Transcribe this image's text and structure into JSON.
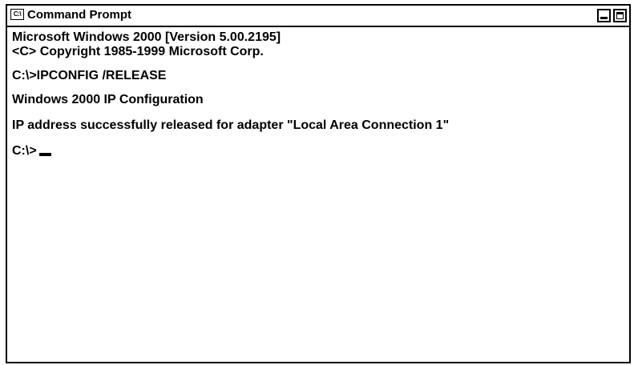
{
  "window": {
    "title": "Command Prompt",
    "icon_label": "C:\\",
    "icon": "console-icon"
  },
  "controls": {
    "minimize_icon": "minimize-icon",
    "maximize_icon": "maximize-icon"
  },
  "console": {
    "banner_line_1": "Microsoft Windows 2000 [Version 5.00.2195]",
    "banner_line_2": "<C> Copyright 1985-1999 Microsoft Corp.",
    "command_line": "C:\\>IPCONFIG /RELEASE",
    "output_heading": "Windows 2000 IP Configuration",
    "output_message": "IP address successfully released for adapter \"Local Area Connection 1\"",
    "prompt": "C:\\>"
  },
  "colors": {
    "foreground": "#000000",
    "background": "#ffffff"
  }
}
